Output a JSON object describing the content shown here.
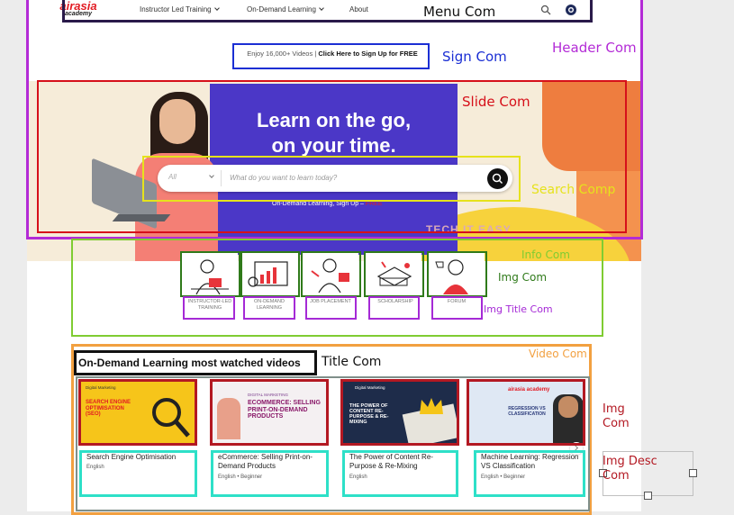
{
  "nav": {
    "logo_top": "airasia",
    "logo_bottom": "academy",
    "links": [
      "Instructor Led Training",
      "On-Demand Learning",
      "About"
    ]
  },
  "sign_bar": {
    "prefix": "Enjoy 16,000+ Videos |",
    "cta": "Click Here to Sign Up for FREE"
  },
  "banner": {
    "headline_1": "Learn on the go,",
    "headline_2": "on your time.",
    "search_select": "All",
    "search_placeholder": "What do you want to learn today?",
    "signup_text": "On-Demand Learning, Sign Up –",
    "signup_link": "FREE",
    "tagline": "TECH IT EASY"
  },
  "info_cards": [
    {
      "title": "INSTRUCTOR-LED TRAINING"
    },
    {
      "title": "ON-DEMAND LEARNING"
    },
    {
      "title": "JOB PLACEMENT"
    },
    {
      "title": "SCHOLARSHIP"
    },
    {
      "title": "FORUM"
    }
  ],
  "videos": {
    "section_title": "On-Demand Learning most watched videos",
    "items": [
      {
        "thumb_category": "Digital Marketing",
        "thumb_text": "SEARCH ENGINE OPTIMISATION (SEO)",
        "title": "Search Engine Optimisation",
        "meta": "English"
      },
      {
        "thumb_category": "DIGITAL MARKETING",
        "thumb_text": "ECOMMERCE: SELLING PRINT-ON-DEMAND PRODUCTS",
        "title": "eCommerce: Selling Print-on-Demand Products",
        "meta": "English • Beginner"
      },
      {
        "thumb_category": "Digital Marketing",
        "thumb_text": "THE POWER OF CONTENT RE-PURPOSE & RE-MIXING",
        "title": "The Power of Content Re-Purpose & Re-Mixing",
        "meta": "English"
      },
      {
        "thumb_category": "airasia academy",
        "thumb_text": "REGRESSION VS CLASSIFICATION",
        "title": "Machine Learning: Regression VS Classification",
        "meta": "English • Beginner"
      }
    ]
  },
  "annotations": {
    "menu": "Menu Com",
    "header": "Header Com",
    "sign": "Sign Com",
    "slide": "Slide Com",
    "search": "Search Comp",
    "info": "Info Com",
    "img": "Img Com",
    "img_title": "Img Title Com",
    "video": "Video Com",
    "title": "Title Com",
    "img_right_1": "Img",
    "img_right_2": "Com",
    "img_desc_1": "Img Desc",
    "img_desc_2": "Com"
  },
  "colors": {
    "header_box": "#b32bd6",
    "menu_box": "#2a1a4a",
    "sign_box": "#1b2fd4",
    "slide_box": "#d6101a",
    "search_box": "#e6e21c",
    "info_box": "#7fcc32",
    "img_box": "#2f7a1a",
    "img_title_box": "#a52ad6",
    "video_box": "#f2a040",
    "title_box": "#111111",
    "thumb_box": "#b31822",
    "desc_box": "#2ee0c8",
    "banner_blue": "#4b37c7",
    "brand_red": "#e21b23"
  }
}
